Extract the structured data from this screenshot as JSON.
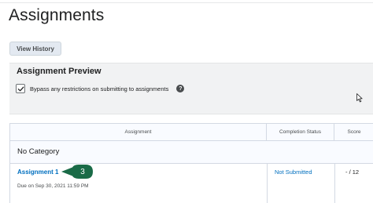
{
  "page": {
    "title": "Assignments"
  },
  "toolbar": {
    "view_history_label": "View History"
  },
  "preview": {
    "title": "Assignment Preview",
    "bypass_label": "Bypass any restrictions on submitting to assignments",
    "bypass_checked": true,
    "help_icon_glyph": "?"
  },
  "table": {
    "headers": {
      "assignment": "Assignment",
      "completion_status": "Completion Status",
      "score": "Score"
    },
    "category": "No Category",
    "rows": [
      {
        "name": "Assignment 1",
        "due": "Due on Sep 30, 2021 11:59 PM",
        "status": "Not Submitted",
        "score": "- / 12",
        "callout_number": "3"
      }
    ]
  },
  "colors": {
    "link": "#006fbf",
    "callout": "#1a6b47",
    "panel_bg": "#f1f2f3",
    "button_bg": "#e3e9f1"
  },
  "icons": [
    "checkmark-icon",
    "help-icon",
    "mouse-cursor-icon",
    "callout-pointer"
  ]
}
